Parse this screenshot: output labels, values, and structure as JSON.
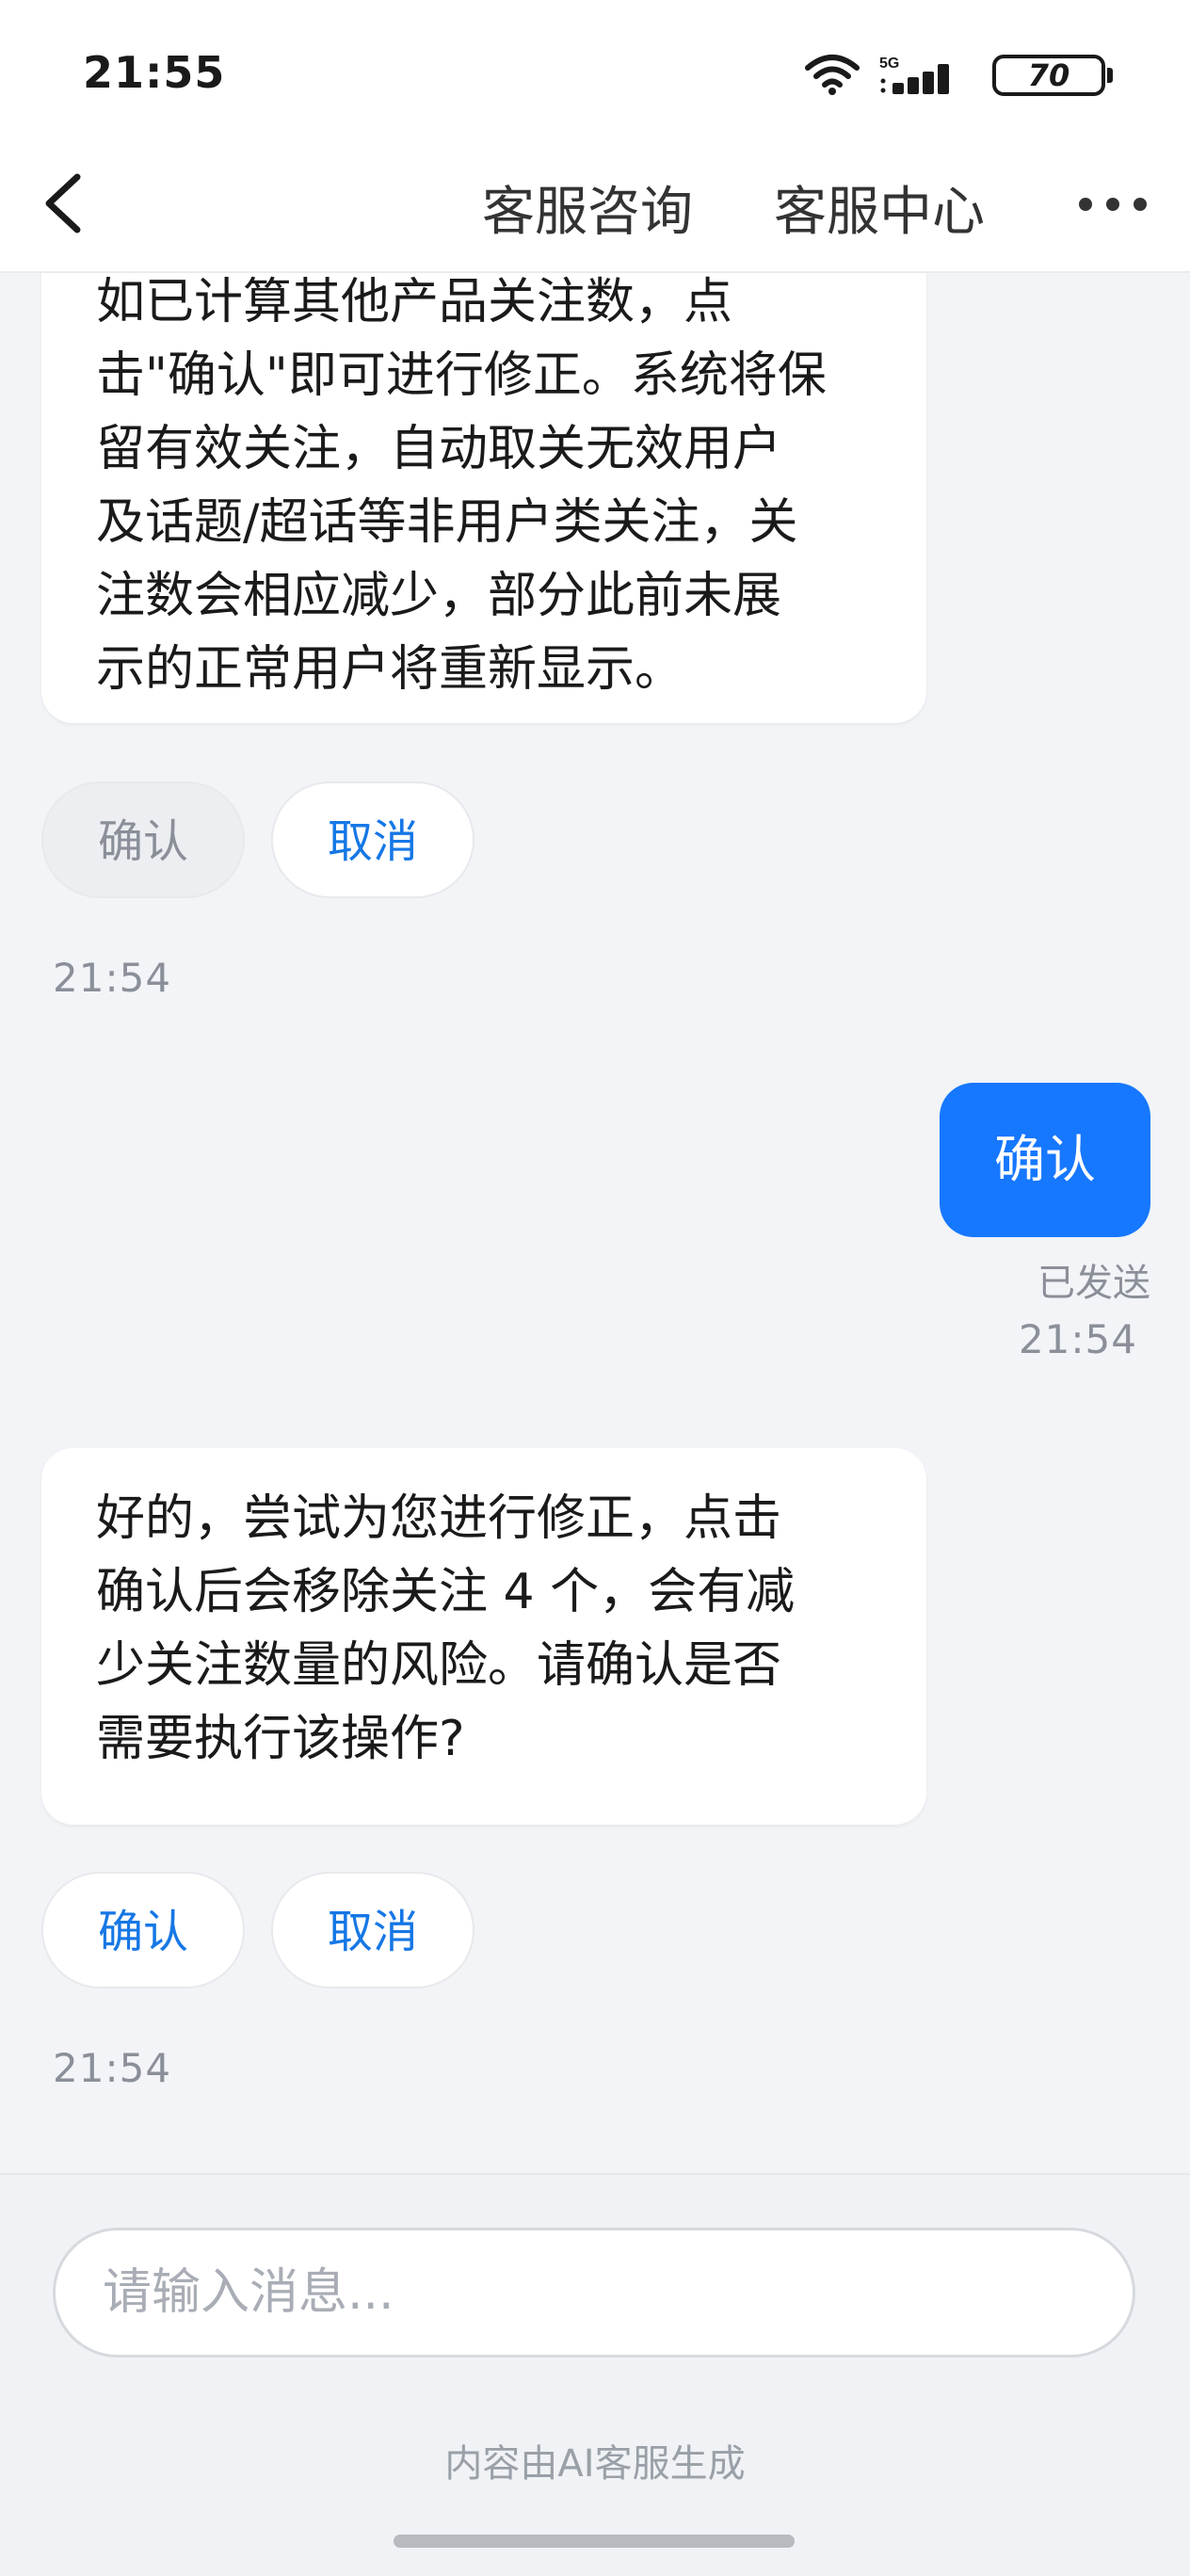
{
  "status_bar": {
    "time": "21:55",
    "network": "5G",
    "battery": "70"
  },
  "header": {
    "tab_primary": "客服咨询",
    "tab_secondary": "客服中心"
  },
  "messages": {
    "first_bubble_lines": [
      "如已计算其他产品关注数，点",
      "击\"确认\"即可进行修正。系统将保",
      "留有效关注，自动取关无效用户",
      "及话题/超话等非用户类关注，关",
      "注数会相应减少，部分此前未展",
      "示的正常用户将重新显示。"
    ],
    "first_actions": {
      "confirm": "确认",
      "cancel": "取消"
    },
    "first_time": "21:54",
    "user_reply": "确认",
    "user_reply_status": "已发送",
    "user_reply_time": "21:54",
    "second_bubble_lines": [
      "好的，尝试为您进行修正，点击",
      "确认后会移除关注 4 个，会有减",
      "少关注数量的风险。请确认是否",
      "需要执行该操作?"
    ],
    "second_actions": {
      "confirm": "确认",
      "cancel": "取消"
    },
    "second_time": "21:54"
  },
  "footer": {
    "input_placeholder": "请输入消息...",
    "ai_note": "内容由AI客服生成"
  },
  "colors": {
    "accent": "#1677ff",
    "link": "#1677e5",
    "background": "#f2f4f7",
    "muted": "#8a8f99"
  }
}
